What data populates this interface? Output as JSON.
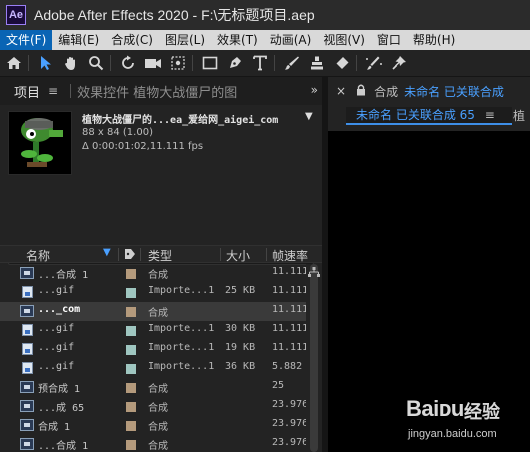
{
  "window": {
    "app_badge": "Ae",
    "title": "Adobe After Effects 2020 - F:\\无标题项目.aep"
  },
  "menu": [
    "文件(F)",
    "编辑(E)",
    "合成(C)",
    "图层(L)",
    "效果(T)",
    "动画(A)",
    "视图(V)",
    "窗口",
    "帮助(H)"
  ],
  "toolbar": {
    "tools": [
      "home-icon",
      "selection-arrow-icon",
      "hand-icon",
      "zoom-icon",
      "rotate-icon",
      "camera-icon",
      "pan-behind-icon",
      "rectangle-icon",
      "pen-icon",
      "type-icon",
      "brush-icon",
      "clone-stamp-icon",
      "eraser-icon",
      "roto-brush-icon",
      "puppet-pin-icon"
    ]
  },
  "project_panel": {
    "tab_label": "项目",
    "tab_menu_symbol": "≡",
    "inactive_tab": "效果控件 植物大战僵尸的图",
    "expand_symbol": "»",
    "preview": {
      "name": "植物大战僵尸的...ea_爱给网_aigei_com",
      "dropdown_symbol": "▼",
      "size": "88 x 84 (1.00)",
      "duration": "Δ 0:00:01:02,11.111 fps"
    },
    "search_symbol": "ρ▾",
    "columns": {
      "name": "名称",
      "type": "类型",
      "size": "大小",
      "fps": "帧速率"
    },
    "rows": [
      {
        "name": "...合成 1",
        "icon": "comp",
        "label_color": "#b49a7c",
        "type": "合成",
        "size": "",
        "fps": "11.111"
      },
      {
        "name": "...gif",
        "icon": "file",
        "label_color": "#9fc6c0",
        "type": "Importe...1",
        "size": "25 KB",
        "fps": "11.111"
      },
      {
        "name": "..._com",
        "icon": "comp",
        "label_color": "#b49a7c",
        "type": "合成",
        "size": "",
        "fps": "11.111",
        "selected": true
      },
      {
        "name": "...gif",
        "icon": "file",
        "label_color": "#9fc6c0",
        "type": "Importe...1",
        "size": "30 KB",
        "fps": "11.111"
      },
      {
        "name": "...gif",
        "icon": "file",
        "label_color": "#9fc6c0",
        "type": "Importe...1",
        "size": "19 KB",
        "fps": "11.111"
      },
      {
        "name": "...gif",
        "icon": "file",
        "label_color": "#9fc6c0",
        "type": "Importe...1",
        "size": "36 KB",
        "fps": "5.882"
      },
      {
        "name": "预合成 1",
        "icon": "comp",
        "label_color": "#b49a7c",
        "type": "合成",
        "size": "",
        "fps": "25"
      },
      {
        "name": "...成 65",
        "icon": "comp",
        "label_color": "#b49a7c",
        "type": "合成",
        "size": "",
        "fps": "23.976"
      },
      {
        "name": "合成 1",
        "icon": "comp",
        "label_color": "#b49a7c",
        "type": "合成",
        "size": "",
        "fps": "23.976"
      },
      {
        "name": "...合成 1",
        "icon": "comp",
        "label_color": "#b49a7c",
        "type": "合成",
        "size": "",
        "fps": "23.976"
      }
    ]
  },
  "composition_panel": {
    "close_symbol": "×",
    "kind_label": "合成",
    "title": "未命名 已关联合成",
    "tab": "未命名 已关联合成 65",
    "tab_close": "≡",
    "next_tab": "植"
  },
  "watermark": {
    "logo": "Baiᴅu",
    "cn": "经验",
    "url": "jingyan.baidu.com"
  },
  "colors": {
    "accent": "#4aa0ff",
    "menu_active": "#0a64b4",
    "panel_bg": "#232323"
  }
}
